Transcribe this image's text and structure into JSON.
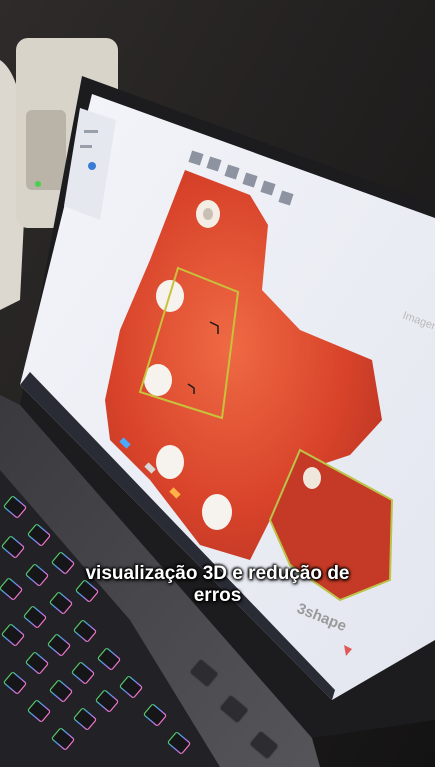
{
  "caption": {
    "line1": "visualização 3D e redução de",
    "line2": "erros"
  },
  "screen": {
    "side_label": "Imagen",
    "brand": "3shape",
    "brand_icon": "triangle-logo"
  },
  "colors": {
    "scan_tissue": "#d9442b",
    "selection_box": "#c8c23a",
    "screen_bg": "#eef0f6",
    "keyboard_glow": "#b57cff"
  }
}
